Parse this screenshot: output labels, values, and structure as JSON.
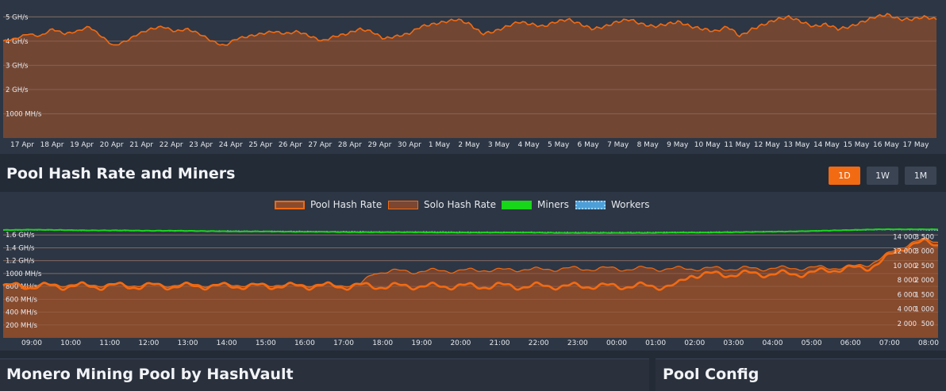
{
  "top_chart": {
    "chart_data": {
      "type": "area",
      "series": [
        {
          "values": [
            4.0,
            4.1,
            4.3,
            4.2,
            4.5,
            4.3,
            4.4,
            4.6,
            4.2,
            3.8,
            4.0,
            4.3,
            4.5,
            4.6,
            4.4,
            4.5,
            4.3,
            4.0,
            3.8,
            4.1,
            4.2,
            4.3,
            4.4,
            4.3,
            4.4,
            4.2,
            4.0,
            4.2,
            4.3,
            4.5,
            4.4,
            4.1,
            4.2,
            4.3,
            4.6,
            4.7,
            4.8,
            4.9,
            4.7,
            4.3,
            4.4,
            4.6,
            4.8,
            4.7,
            4.6,
            4.8,
            4.9,
            4.7,
            4.5,
            4.6,
            4.8,
            4.9,
            4.7,
            4.6,
            4.7,
            4.8,
            4.6,
            4.5,
            4.4,
            4.6,
            4.2,
            4.5,
            4.7,
            4.9,
            5.0,
            4.8,
            4.6,
            4.7,
            4.5,
            4.6,
            4.8,
            5.0,
            5.1,
            4.9,
            4.9,
            5.0,
            4.9
          ]
        }
      ],
      "x_tick_labels": [
        "17 Apr",
        "18 Apr",
        "19 Apr",
        "20 Apr",
        "21 Apr",
        "22 Apr",
        "23 Apr",
        "24 Apr",
        "25 Apr",
        "26 Apr",
        "27 Apr",
        "28 Apr",
        "29 Apr",
        "30 Apr",
        "1 May",
        "2 May",
        "3 May",
        "4 May",
        "5 May",
        "6 May",
        "7 May",
        "8 May",
        "9 May",
        "10 May",
        "11 May",
        "12 May",
        "13 May",
        "14 May",
        "15 May",
        "16 May",
        "17 May"
      ],
      "y_tick_labels": [
        "5 GH/s",
        "4 GH/s",
        "3 GH/s",
        "2 GH/s",
        "1000 MH/s"
      ],
      "y_tick_values": [
        5,
        4,
        3,
        2,
        1
      ],
      "ylim": [
        0,
        5.5
      ],
      "grid": true,
      "colors": {
        "line": "#f26a12",
        "fill": "#7e4a31"
      }
    }
  },
  "section": {
    "title": "Pool Hash Rate and Miners",
    "buttons": [
      {
        "id": "1D",
        "label": "1D",
        "active": true
      },
      {
        "id": "1W",
        "label": "1W",
        "active": false
      },
      {
        "id": "1M",
        "label": "1M",
        "active": false
      }
    ]
  },
  "legend": {
    "pool": "Pool Hash Rate",
    "solo": "Solo Hash Rate",
    "miners": "Miners",
    "workers": "Workers",
    "colors": {
      "pool": "#f26a12",
      "solo": "#b55a2a",
      "miners": "#18d619",
      "workers": "#4e9fd8"
    }
  },
  "bottom_chart": {
    "chart_data": {
      "type": "area",
      "x_tick_labels": [
        "09:00",
        "10:00",
        "11:00",
        "12:00",
        "13:00",
        "14:00",
        "15:00",
        "16:00",
        "17:00",
        "18:00",
        "19:00",
        "20:00",
        "21:00",
        "22:00",
        "23:00",
        "00:00",
        "01:00",
        "02:00",
        "03:00",
        "04:00",
        "05:00",
        "06:00",
        "07:00",
        "08:00"
      ],
      "y_left_tick_labels": [
        "1.6 GH/s",
        "1.4 GH/s",
        "1.2 GH/s",
        "1000 MH/s",
        "800 MH/s",
        "600 MH/s",
        "400 MH/s",
        "200 MH/s"
      ],
      "y_left_tick_values": [
        1600,
        1400,
        1200,
        1000,
        800,
        600,
        400,
        200
      ],
      "ylim_left": [
        0,
        1800
      ],
      "y_right1_tick_labels": [
        "14 000",
        "12 000",
        "10 000",
        "8 000",
        "6 000",
        "4 000",
        "2 000"
      ],
      "y_right1_tick_values": [
        14000,
        12000,
        10000,
        8000,
        6000,
        4000,
        2000
      ],
      "ylim_right1": [
        0,
        16000
      ],
      "y_right2_tick_labels": [
        "3 500",
        "3 000",
        "2 500",
        "2 000",
        "1 500",
        "1 000",
        "500"
      ],
      "y_right2_tick_values": [
        3500,
        3000,
        2500,
        2000,
        1500,
        1000,
        500
      ],
      "ylim_right2": [
        0,
        4000
      ],
      "series": [
        {
          "name": "Pool Hash Rate",
          "values": [
            800,
            810,
            800,
            805,
            800,
            810,
            805,
            800,
            810,
            805,
            800,
            810,
            805,
            800,
            805,
            810,
            800,
            810,
            800,
            805,
            810,
            800,
            805,
            810,
            805,
            800,
            810,
            805,
            800,
            805,
            810,
            800,
            805,
            810,
            800,
            805,
            810,
            805,
            800,
            805,
            810,
            800,
            805,
            810,
            800,
            805,
            810,
            800,
            805,
            810,
            980,
            990,
            985,
            990,
            995,
            1000,
            990,
            995,
            1000,
            1010,
            1060,
            1070,
            1080,
            1100,
            1200,
            1350,
            1450,
            1480,
            1460
          ]
        },
        {
          "name": "Solo Hash Rate",
          "values": [
            820,
            825,
            830,
            820,
            825,
            830,
            820,
            825,
            830,
            820,
            825,
            830,
            820,
            825,
            830,
            820,
            825,
            830,
            820,
            825,
            830,
            820,
            825,
            830,
            820,
            825,
            830,
            1020,
            1030,
            1040,
            1030,
            1040,
            1050,
            1040,
            1050,
            1060,
            1050,
            1060,
            1070,
            1060,
            1070,
            1080,
            1070,
            1075,
            1080,
            1070,
            1075,
            1080,
            1070,
            1075,
            1080,
            1075,
            1080,
            1075,
            1080,
            1075,
            1085,
            1080,
            1085,
            1090,
            1090,
            1095,
            1110,
            1150,
            1250,
            1380,
            1480,
            1520,
            1500
          ]
        },
        {
          "name": "Miners",
          "values": [
            14900,
            14950,
            14900,
            14850,
            14850,
            14800,
            14800,
            14750,
            14700,
            14700,
            14650,
            14650,
            14600,
            14600,
            14600,
            14550,
            14550,
            14550,
            14550,
            14500,
            14500,
            14500,
            14500,
            14550,
            14550,
            14600,
            14650,
            14700,
            14800,
            14900,
            15000,
            15000,
            15000
          ]
        },
        {
          "name": "Workers",
          "values": [
            3720,
            3730,
            3720,
            3710,
            3710,
            3700,
            3700,
            3690,
            3690,
            3680,
            3680,
            3670,
            3670,
            3660,
            3660,
            3660,
            3650,
            3650,
            3650,
            3640,
            3640,
            3640,
            3640,
            3650,
            3650,
            3660,
            3670,
            3680,
            3700,
            3720,
            3740,
            3740,
            3720
          ]
        }
      ],
      "grid": true
    }
  },
  "panels": {
    "left_title": "Monero Mining Pool by HashVault",
    "right_title": "Pool Config"
  }
}
